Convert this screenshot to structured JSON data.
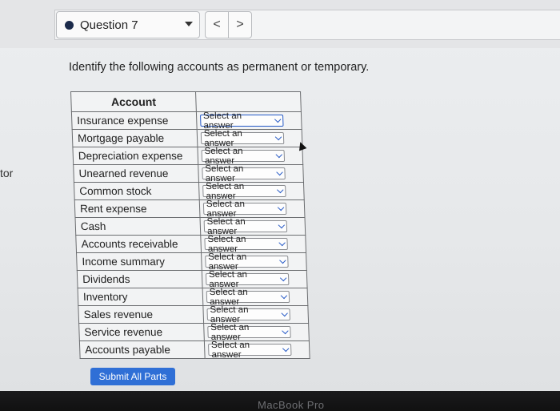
{
  "question_nav": {
    "label": "Question 7",
    "prev_symbol": "<",
    "next_symbol": ">"
  },
  "side_label": "tor",
  "prompt": "Identify the following accounts as permanent or temporary.",
  "table": {
    "header_account": "Account",
    "header_answer": "",
    "rows": [
      {
        "account": "Insurance expense",
        "answer": "Select an answer"
      },
      {
        "account": "Mortgage payable",
        "answer": "Select an answer"
      },
      {
        "account": "Depreciation expense",
        "answer": "Select an answer"
      },
      {
        "account": "Unearned revenue",
        "answer": "Select an answer"
      },
      {
        "account": "Common stock",
        "answer": "Select an answer"
      },
      {
        "account": "Rent expense",
        "answer": "Select an answer"
      },
      {
        "account": "Cash",
        "answer": "Select an answer"
      },
      {
        "account": "Accounts receivable",
        "answer": "Select an answer"
      },
      {
        "account": "Income summary",
        "answer": "Select an answer"
      },
      {
        "account": "Dividends",
        "answer": "Select an answer"
      },
      {
        "account": "Inventory",
        "answer": "Select an answer"
      },
      {
        "account": "Sales revenue",
        "answer": "Select an answer"
      },
      {
        "account": "Service revenue",
        "answer": "Select an answer"
      },
      {
        "account": "Accounts payable",
        "answer": "Select an answer"
      }
    ]
  },
  "submit_label": "Submit All Parts",
  "bezel_text": "MacBook Pro",
  "colors": {
    "accent": "#2f6fd6",
    "focus": "#2458c6",
    "bullet": "#1b2a4a"
  }
}
